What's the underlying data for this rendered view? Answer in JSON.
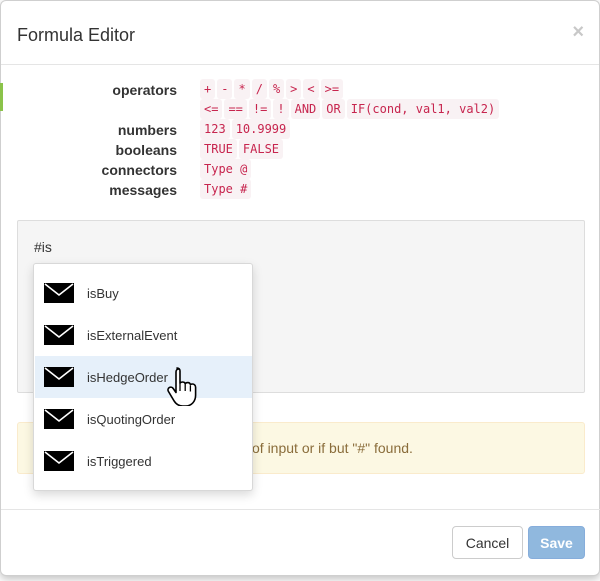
{
  "dialog": {
    "title": "Formula Editor",
    "close_symbol": "×"
  },
  "reference": [
    {
      "label": "operators",
      "tokens": [
        "+",
        "-",
        "*",
        "/",
        "%",
        ">",
        "<",
        ">="
      ]
    },
    {
      "label": "",
      "tokens": [
        "<=",
        "==",
        "!=",
        "!",
        "AND",
        "OR",
        "IF(cond, val1, val2)"
      ]
    },
    {
      "label": "numbers",
      "tokens": [
        "123",
        "10.9999"
      ]
    },
    {
      "label": "booleans",
      "tokens": [
        "TRUE",
        "FALSE"
      ]
    },
    {
      "label": "connectors",
      "tokens": [
        "Type @"
      ]
    },
    {
      "label": "messages",
      "tokens": [
        "Type #"
      ]
    }
  ],
  "editor": {
    "value": "#is"
  },
  "alert": {
    "text": "of input or if but \"#\" found."
  },
  "autocomplete": {
    "icon": "envelope-icon",
    "selected_index": 2,
    "items": [
      "isBuy",
      "isExternalEvent",
      "isHedgeOrder",
      "isQuotingOrder",
      "isTriggered"
    ]
  },
  "footer": {
    "cancel_label": "Cancel",
    "save_label": "Save"
  },
  "colors": {
    "code_text": "#c7254e",
    "code_bg": "#f9f2f4",
    "alert_bg": "#fcf8e3",
    "alert_text": "#8a6d3b",
    "save_button": "#90b8de",
    "selected_item": "#e6f0fa"
  }
}
